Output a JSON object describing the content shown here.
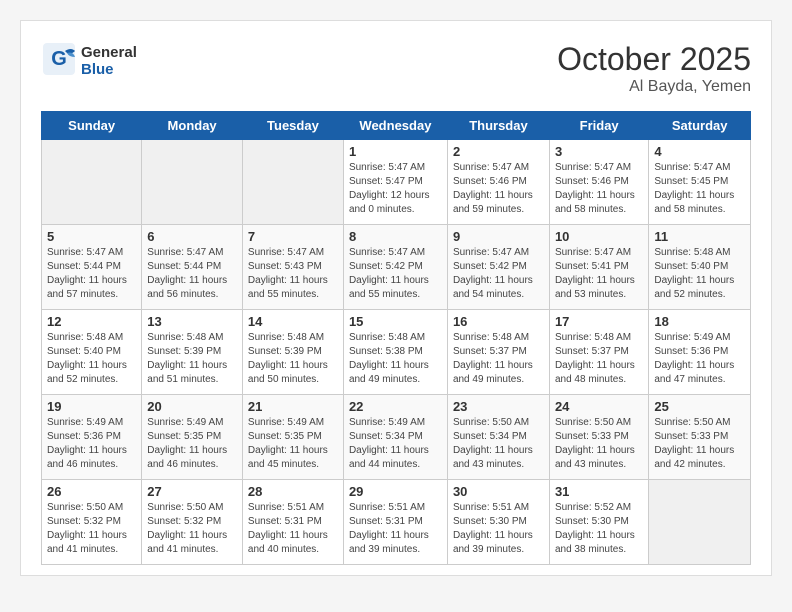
{
  "header": {
    "logo_line1": "General",
    "logo_line2": "Blue",
    "month": "October 2025",
    "location": "Al Bayda, Yemen"
  },
  "weekdays": [
    "Sunday",
    "Monday",
    "Tuesday",
    "Wednesday",
    "Thursday",
    "Friday",
    "Saturday"
  ],
  "weeks": [
    [
      {
        "day": "",
        "info": ""
      },
      {
        "day": "",
        "info": ""
      },
      {
        "day": "",
        "info": ""
      },
      {
        "day": "1",
        "info": "Sunrise: 5:47 AM\nSunset: 5:47 PM\nDaylight: 12 hours\nand 0 minutes."
      },
      {
        "day": "2",
        "info": "Sunrise: 5:47 AM\nSunset: 5:46 PM\nDaylight: 11 hours\nand 59 minutes."
      },
      {
        "day": "3",
        "info": "Sunrise: 5:47 AM\nSunset: 5:46 PM\nDaylight: 11 hours\nand 58 minutes."
      },
      {
        "day": "4",
        "info": "Sunrise: 5:47 AM\nSunset: 5:45 PM\nDaylight: 11 hours\nand 58 minutes."
      }
    ],
    [
      {
        "day": "5",
        "info": "Sunrise: 5:47 AM\nSunset: 5:44 PM\nDaylight: 11 hours\nand 57 minutes."
      },
      {
        "day": "6",
        "info": "Sunrise: 5:47 AM\nSunset: 5:44 PM\nDaylight: 11 hours\nand 56 minutes."
      },
      {
        "day": "7",
        "info": "Sunrise: 5:47 AM\nSunset: 5:43 PM\nDaylight: 11 hours\nand 55 minutes."
      },
      {
        "day": "8",
        "info": "Sunrise: 5:47 AM\nSunset: 5:42 PM\nDaylight: 11 hours\nand 55 minutes."
      },
      {
        "day": "9",
        "info": "Sunrise: 5:47 AM\nSunset: 5:42 PM\nDaylight: 11 hours\nand 54 minutes."
      },
      {
        "day": "10",
        "info": "Sunrise: 5:47 AM\nSunset: 5:41 PM\nDaylight: 11 hours\nand 53 minutes."
      },
      {
        "day": "11",
        "info": "Sunrise: 5:48 AM\nSunset: 5:40 PM\nDaylight: 11 hours\nand 52 minutes."
      }
    ],
    [
      {
        "day": "12",
        "info": "Sunrise: 5:48 AM\nSunset: 5:40 PM\nDaylight: 11 hours\nand 52 minutes."
      },
      {
        "day": "13",
        "info": "Sunrise: 5:48 AM\nSunset: 5:39 PM\nDaylight: 11 hours\nand 51 minutes."
      },
      {
        "day": "14",
        "info": "Sunrise: 5:48 AM\nSunset: 5:39 PM\nDaylight: 11 hours\nand 50 minutes."
      },
      {
        "day": "15",
        "info": "Sunrise: 5:48 AM\nSunset: 5:38 PM\nDaylight: 11 hours\nand 49 minutes."
      },
      {
        "day": "16",
        "info": "Sunrise: 5:48 AM\nSunset: 5:37 PM\nDaylight: 11 hours\nand 49 minutes."
      },
      {
        "day": "17",
        "info": "Sunrise: 5:48 AM\nSunset: 5:37 PM\nDaylight: 11 hours\nand 48 minutes."
      },
      {
        "day": "18",
        "info": "Sunrise: 5:49 AM\nSunset: 5:36 PM\nDaylight: 11 hours\nand 47 minutes."
      }
    ],
    [
      {
        "day": "19",
        "info": "Sunrise: 5:49 AM\nSunset: 5:36 PM\nDaylight: 11 hours\nand 46 minutes."
      },
      {
        "day": "20",
        "info": "Sunrise: 5:49 AM\nSunset: 5:35 PM\nDaylight: 11 hours\nand 46 minutes."
      },
      {
        "day": "21",
        "info": "Sunrise: 5:49 AM\nSunset: 5:35 PM\nDaylight: 11 hours\nand 45 minutes."
      },
      {
        "day": "22",
        "info": "Sunrise: 5:49 AM\nSunset: 5:34 PM\nDaylight: 11 hours\nand 44 minutes."
      },
      {
        "day": "23",
        "info": "Sunrise: 5:50 AM\nSunset: 5:34 PM\nDaylight: 11 hours\nand 43 minutes."
      },
      {
        "day": "24",
        "info": "Sunrise: 5:50 AM\nSunset: 5:33 PM\nDaylight: 11 hours\nand 43 minutes."
      },
      {
        "day": "25",
        "info": "Sunrise: 5:50 AM\nSunset: 5:33 PM\nDaylight: 11 hours\nand 42 minutes."
      }
    ],
    [
      {
        "day": "26",
        "info": "Sunrise: 5:50 AM\nSunset: 5:32 PM\nDaylight: 11 hours\nand 41 minutes."
      },
      {
        "day": "27",
        "info": "Sunrise: 5:50 AM\nSunset: 5:32 PM\nDaylight: 11 hours\nand 41 minutes."
      },
      {
        "day": "28",
        "info": "Sunrise: 5:51 AM\nSunset: 5:31 PM\nDaylight: 11 hours\nand 40 minutes."
      },
      {
        "day": "29",
        "info": "Sunrise: 5:51 AM\nSunset: 5:31 PM\nDaylight: 11 hours\nand 39 minutes."
      },
      {
        "day": "30",
        "info": "Sunrise: 5:51 AM\nSunset: 5:30 PM\nDaylight: 11 hours\nand 39 minutes."
      },
      {
        "day": "31",
        "info": "Sunrise: 5:52 AM\nSunset: 5:30 PM\nDaylight: 11 hours\nand 38 minutes."
      },
      {
        "day": "",
        "info": ""
      }
    ]
  ]
}
